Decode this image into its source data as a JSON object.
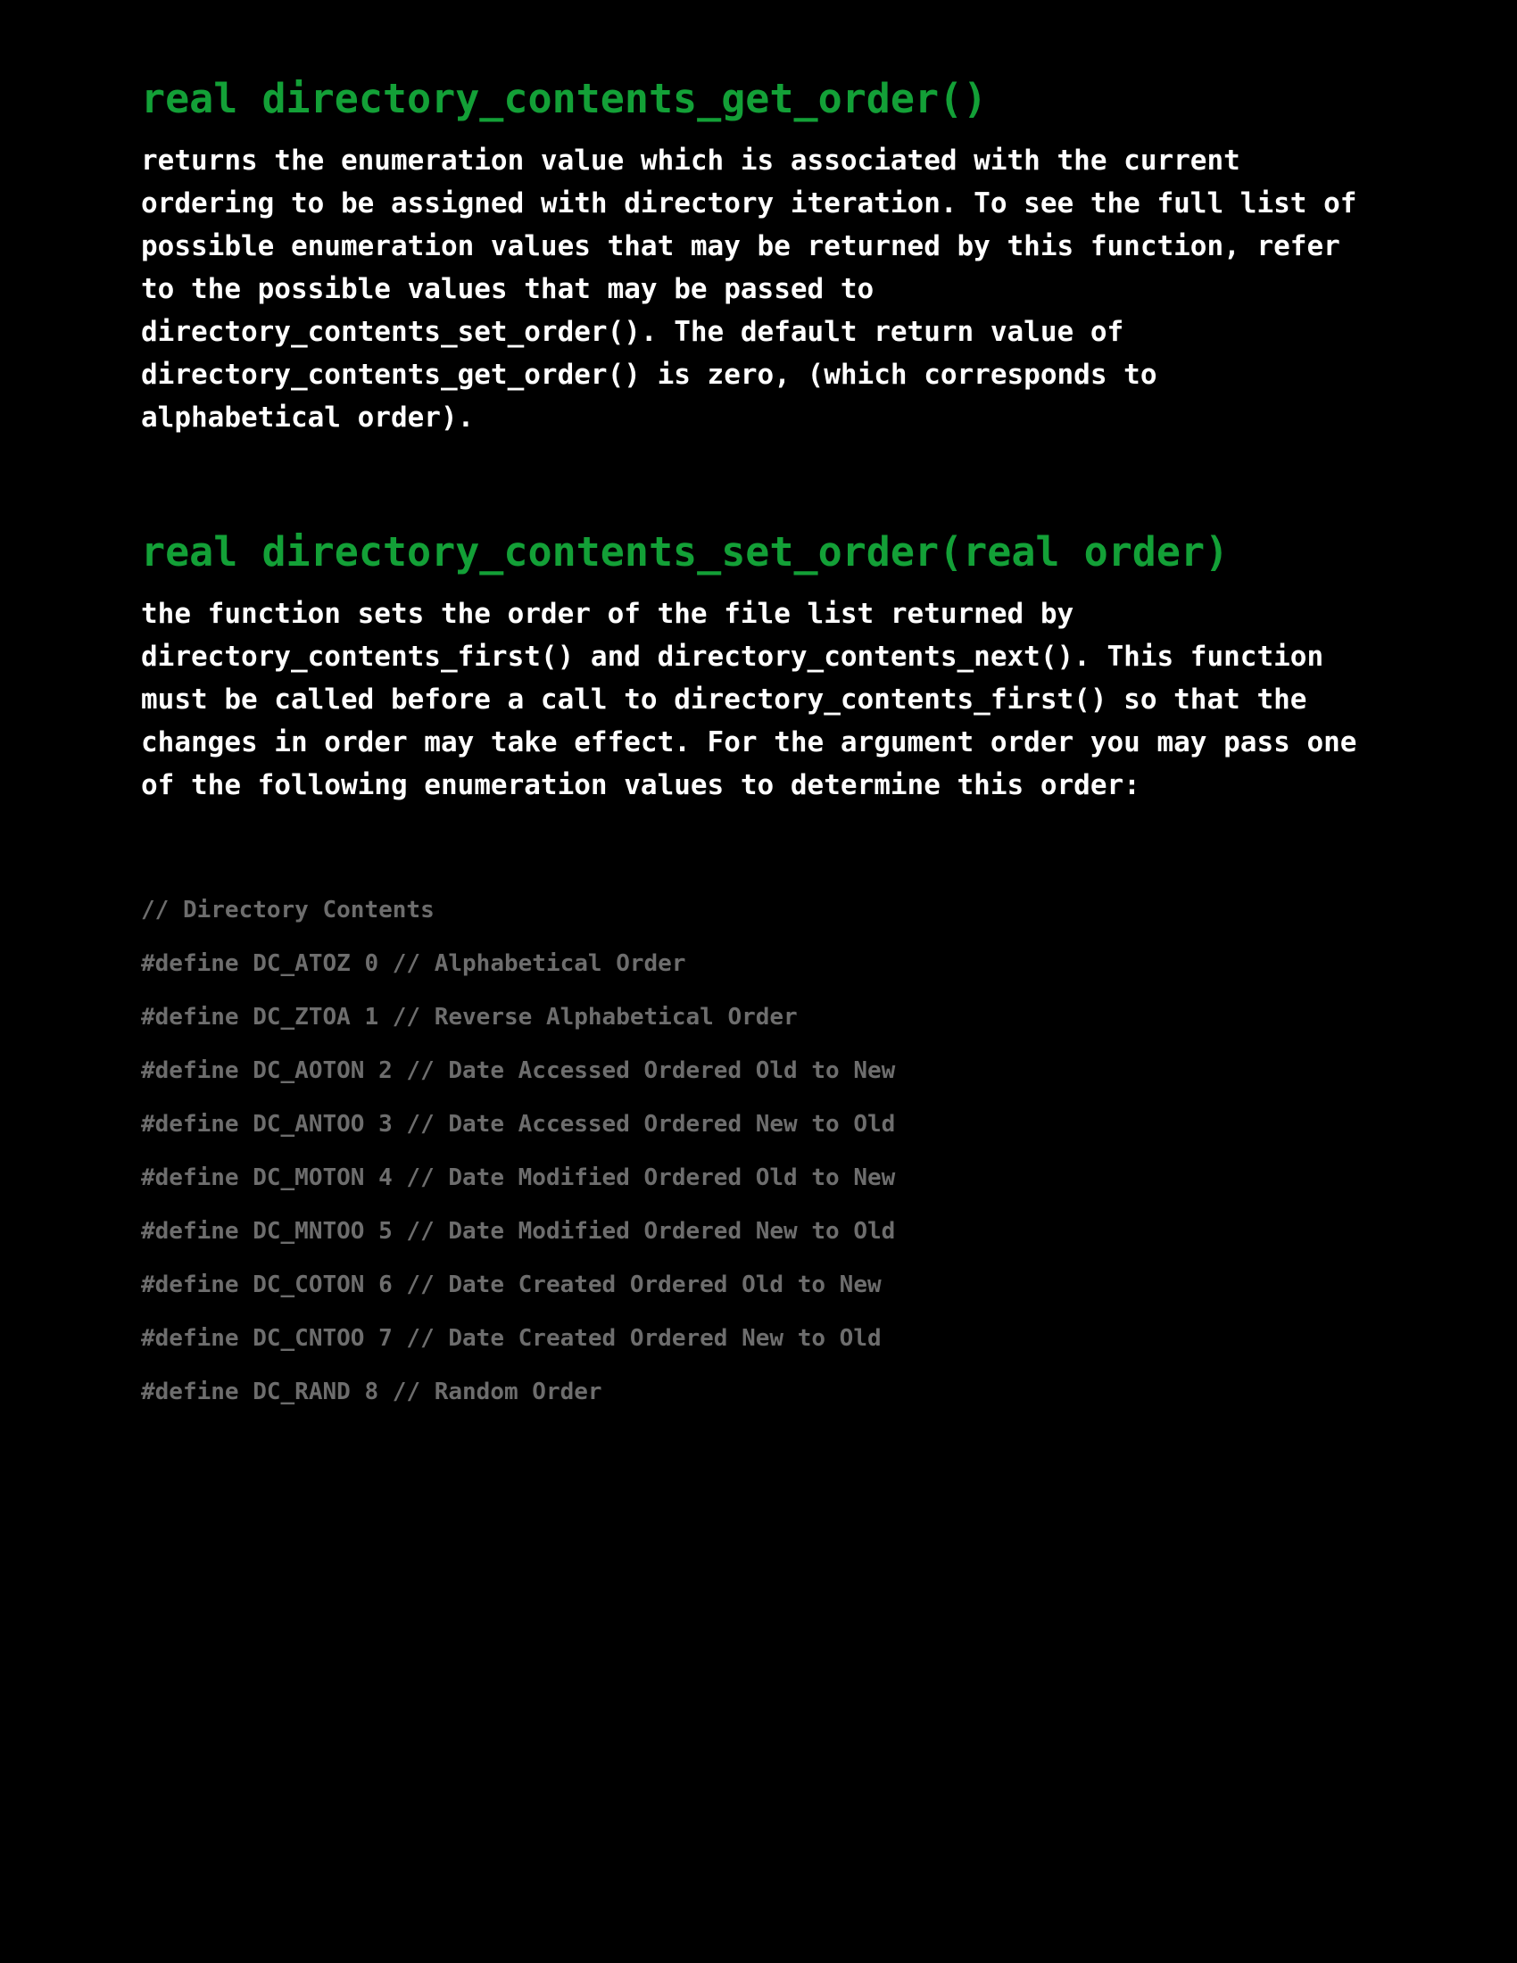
{
  "colors": {
    "background": "#000000",
    "heading": "#13a037",
    "body_text": "#ffffff",
    "code_text": "#6d6d6d"
  },
  "sections": [
    {
      "heading": "real directory_contents_get_order()",
      "body": "returns the enumeration value which is associated with the current\nordering to be assigned with directory iteration. To see the full list of\npossible enumeration values that may be returned by this function, refer\nto the possible values that may be passed to\ndirectory_contents_set_order(). The default return value of\ndirectory_contents_get_order() is zero, (which corresponds to\nalphabetical order)."
    },
    {
      "heading": "real directory_contents_set_order(real order)",
      "body": "the function sets the order of the file list returned by\ndirectory_contents_first() and directory_contents_next(). This function\nmust be called before a call to directory_contents_first() so that the\nchanges in order may take effect. For the argument order you may pass one\nof the following enumeration values to determine this order:"
    }
  ],
  "code_lines": [
    "// Directory Contents",
    "#define DC_ATOZ 0 // Alphabetical Order",
    "#define DC_ZTOA 1 // Reverse Alphabetical Order",
    "#define DC_AOTON 2 // Date Accessed Ordered Old to New",
    "#define DC_ANTOO 3 // Date Accessed Ordered New to Old",
    "#define DC_MOTON 4 // Date Modified Ordered Old to New",
    "#define DC_MNTOO 5 // Date Modified Ordered New to Old",
    "#define DC_COTON 6 // Date Created Ordered Old to New",
    "#define DC_CNTOO 7 // Date Created Ordered New to Old",
    "#define DC_RAND 8 // Random Order"
  ]
}
